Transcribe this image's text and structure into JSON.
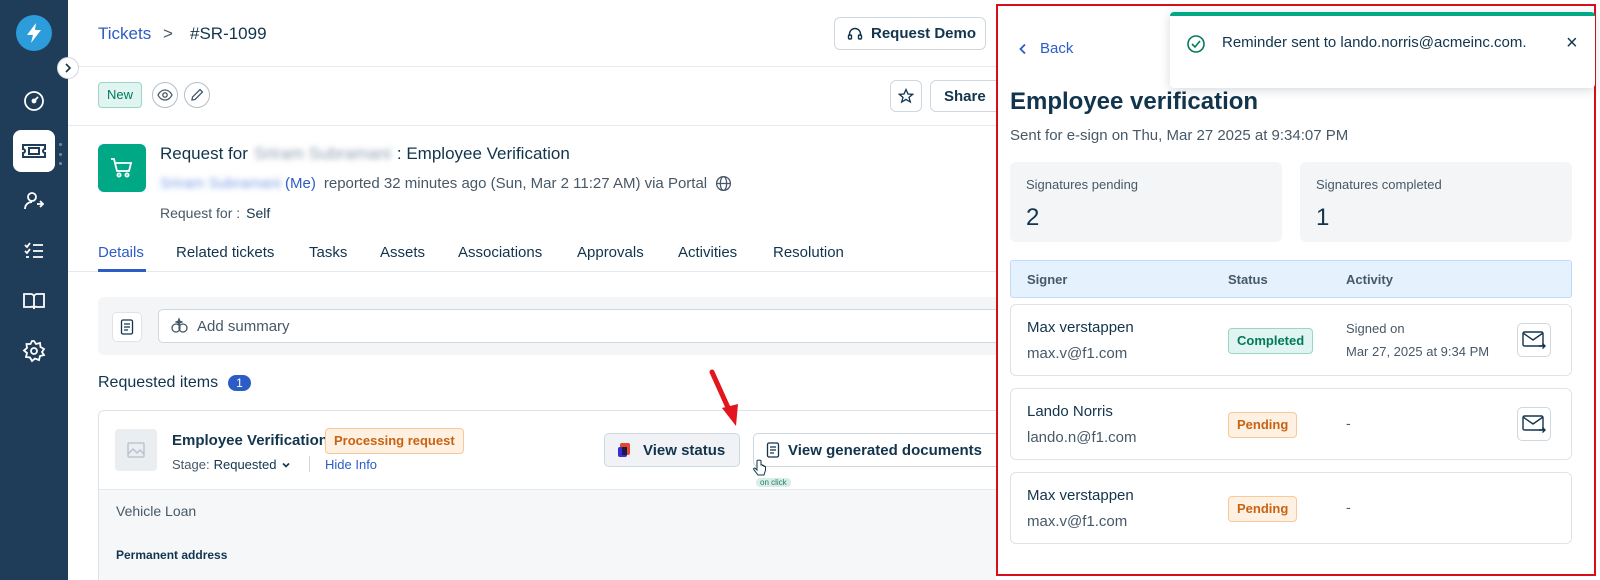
{
  "nav": {
    "items": [
      "dashboard-icon",
      "tickets-icon",
      "contacts-icon",
      "tasks-icon",
      "knowledge-base-icon",
      "settings-icon"
    ],
    "active": "tickets-icon"
  },
  "header": {
    "breadcrumb_link": "Tickets",
    "breadcrumb_sep": ">",
    "breadcrumb_current": "#SR-1099",
    "request_demo": "Request Demo"
  },
  "toolbar": {
    "status_badge": "New",
    "share": "Share"
  },
  "request": {
    "title_prefix": "Request for",
    "requester_name_redacted": "Sriram Subramani",
    "title_suffix": ": Employee Verification",
    "me_suffix": "(Me)",
    "meta_text": "reported 32 minutes ago (Sun, Mar 2 11:27 AM) via Portal",
    "request_for_label": "Request for :",
    "request_for_value": "Self"
  },
  "tabs": [
    "Details",
    "Related tickets",
    "Tasks",
    "Assets",
    "Associations",
    "Approvals",
    "Activities",
    "Resolution"
  ],
  "summary": {
    "placeholder": "Add summary"
  },
  "requested_items": {
    "label": "Requested items",
    "count": "1",
    "item": {
      "name": "Employee Verification",
      "status": "Processing request",
      "stage_label": "Stage:",
      "stage_value": "Requested",
      "hide_info": "Hide Info",
      "view_status": "View status",
      "view_generated": "View generated documents",
      "on_click_hint": "on click",
      "field_value": "Vehicle Loan",
      "field_label": "Permanent address"
    }
  },
  "panel": {
    "back": "Back",
    "title": "Employee verification",
    "subtitle": "Sent for e-sign on Thu, Mar 27 2025 at 9:34:07 PM",
    "stats": [
      {
        "label": "Signatures pending",
        "value": "2"
      },
      {
        "label": "Signatures completed",
        "value": "1"
      }
    ],
    "columns": [
      "Signer",
      "Status",
      "Activity"
    ],
    "signers": [
      {
        "name": "Max verstappen",
        "email": "max.v@f1.com",
        "status": "Completed",
        "activity_line1": "Signed on",
        "activity_line2": "Mar 27, 2025 at 9:34 PM"
      },
      {
        "name": "Lando Norris",
        "email": "lando.n@f1.com",
        "status": "Pending",
        "activity": "-"
      },
      {
        "name": "Max verstappen",
        "email": "max.v@f1.com",
        "status": "Pending",
        "activity": "-"
      }
    ]
  },
  "toast": {
    "message": "Reminder sent to lando.norris@acmeinc.com.",
    "close": "×"
  },
  "colors": {
    "rail": "#1f3d58",
    "link": "#2c5cc5",
    "success": "#00a886",
    "highlight_border": "#d6101a"
  }
}
